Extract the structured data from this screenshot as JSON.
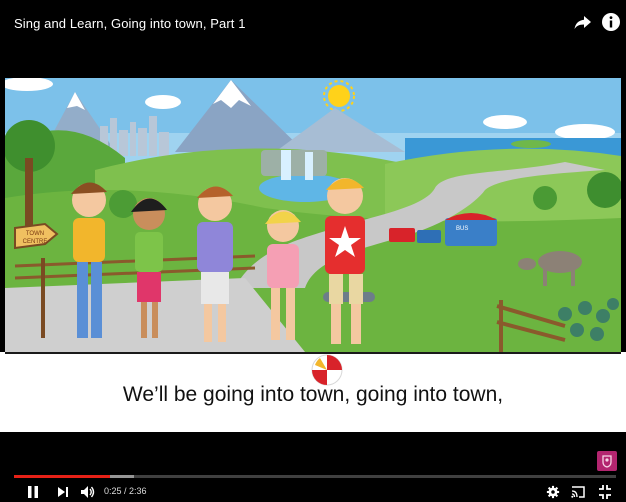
{
  "video": {
    "title": "Sing and Learn, Going into town, Part 1",
    "caption": "We’ll be going into town, going into town,",
    "sign_line1": "TOWN",
    "sign_line2": "CENTRE",
    "bus_sign": "BUS"
  },
  "controls": {
    "current_time": "0:25",
    "separator": " / ",
    "duration": "2:36",
    "progress_fraction": 0.16,
    "buffered_fraction": 0.2
  },
  "icons": {
    "share": "share-arrow-icon",
    "info": "info-icon",
    "pause": "pause-icon",
    "next": "skip-next-icon",
    "volume": "volume-icon",
    "settings": "gear-icon",
    "cast": "cast-icon",
    "exit_fullscreen": "exit-fullscreen-icon"
  },
  "colors": {
    "progress": "#e62117",
    "brand": "#b3256f"
  }
}
